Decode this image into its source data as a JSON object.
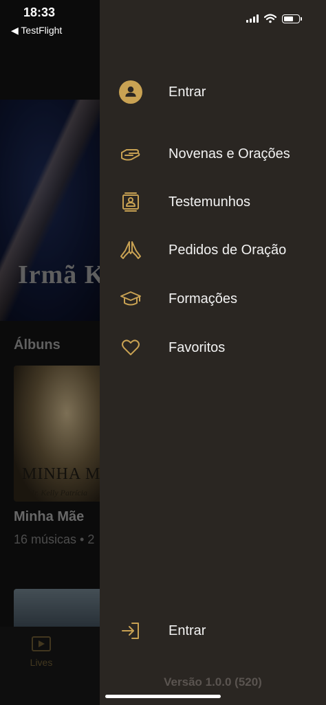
{
  "status_bar": {
    "time": "18:33",
    "back_app": "◀ TestFlight"
  },
  "background": {
    "hero_title": "Irmã K",
    "albums_heading": "Álbuns",
    "album": {
      "cover_title": "MINHA MÃ",
      "cover_subtitle": "Ir. Kelly Patrícia",
      "name": "Minha Mãe",
      "meta": "16 músicas • 2"
    },
    "tab_lives": "Lives"
  },
  "drawer": {
    "login_top": "Entrar",
    "items": [
      {
        "label": "Novenas e Orações",
        "icon": "offering-hands-icon"
      },
      {
        "label": "Testemunhos",
        "icon": "testimony-contact-icon"
      },
      {
        "label": "Pedidos de Oração",
        "icon": "praying-hands-icon"
      },
      {
        "label": "Formações",
        "icon": "graduation-cap-icon"
      },
      {
        "label": "Favoritos",
        "icon": "heart-icon"
      }
    ],
    "login_bottom": "Entrar",
    "version": "Versão 1.0.0 (520)"
  },
  "colors": {
    "accent": "#c9a253",
    "drawer_bg": "#2a2622",
    "version_text": "#5a5450"
  }
}
